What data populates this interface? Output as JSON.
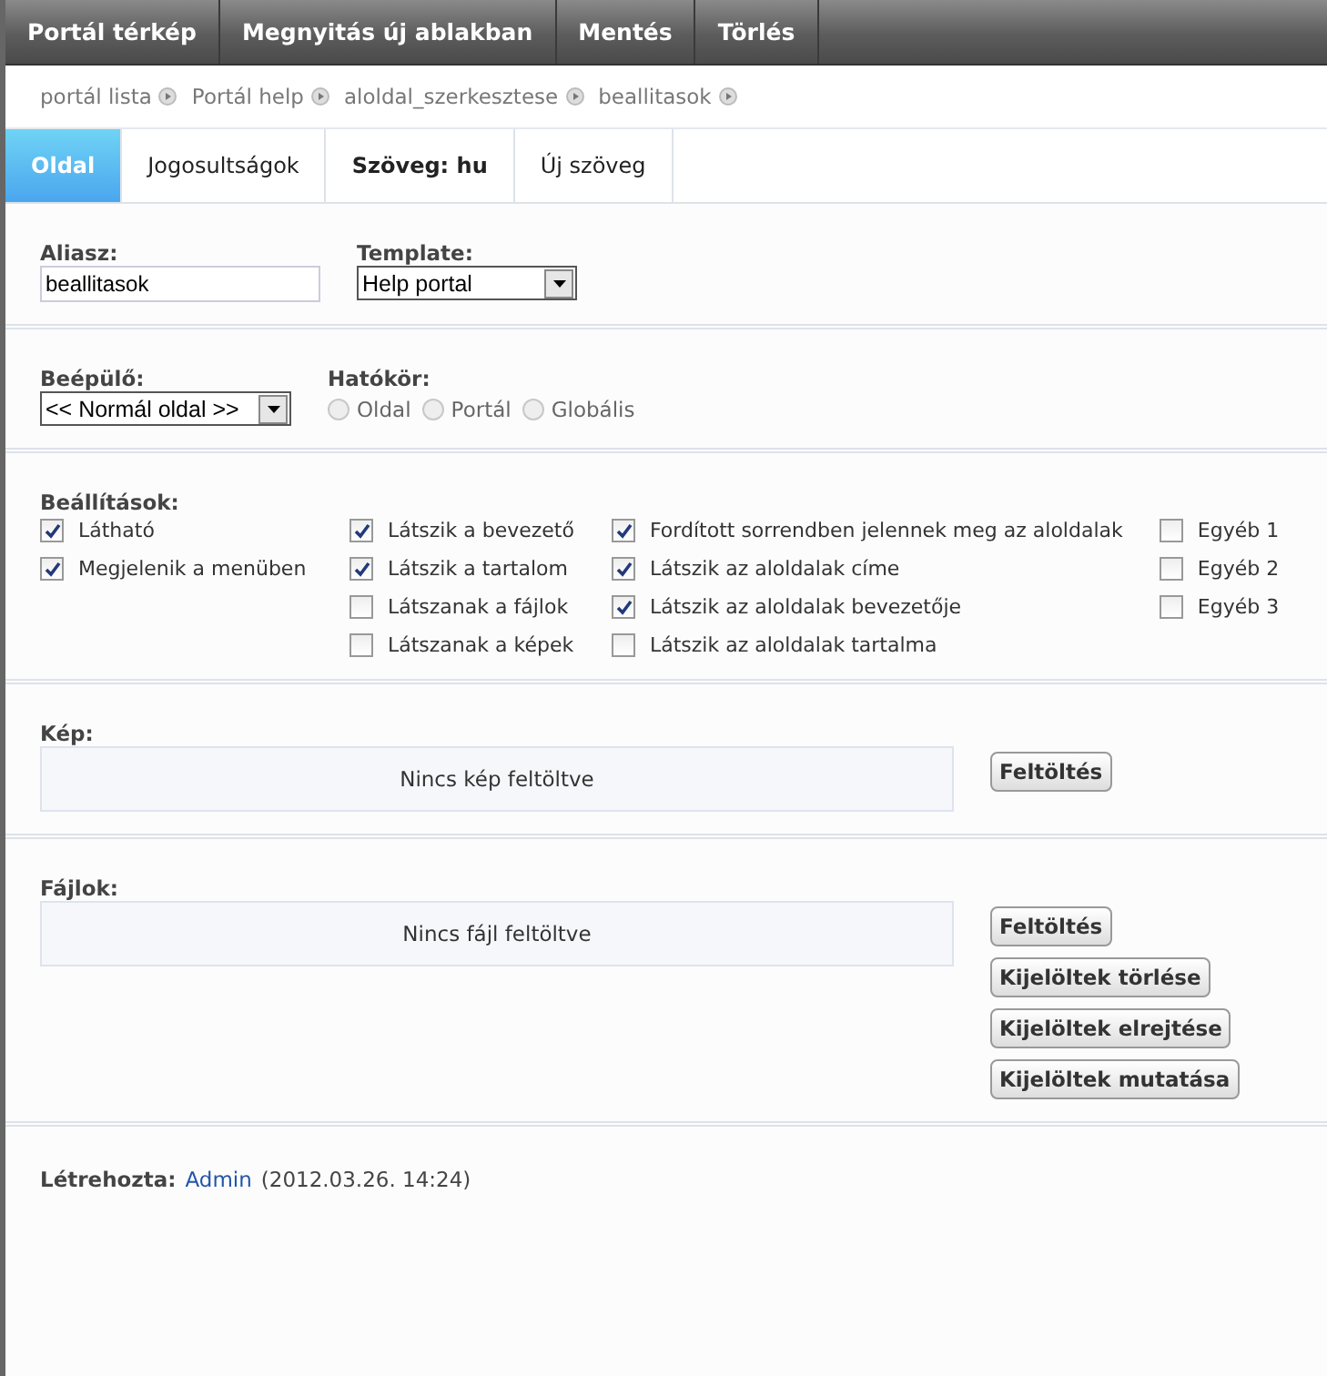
{
  "menu": [
    "Portál térkép",
    "Megnyitás új ablakban",
    "Mentés",
    "Törlés"
  ],
  "breadcrumb": [
    "portál lista",
    "Portál help",
    "aloldal_szerkesztese",
    "beallitasok"
  ],
  "tabs": [
    {
      "label": "Oldal",
      "selected": true,
      "bold": false
    },
    {
      "label": "Jogosultságok",
      "selected": false,
      "bold": false
    },
    {
      "label": "Szöveg: hu",
      "selected": false,
      "bold": true
    },
    {
      "label": "Új szöveg",
      "selected": false,
      "bold": false
    }
  ],
  "alias": {
    "label": "Aliasz:",
    "value": "beallitasok"
  },
  "template": {
    "label": "Template:",
    "value": "Help portal"
  },
  "plugin": {
    "label": "Beépülő:",
    "value": "<< Normál oldal >>"
  },
  "scope": {
    "label": "Hatókör:",
    "options": [
      {
        "label": "Oldal",
        "selected": false
      },
      {
        "label": "Portál",
        "selected": false
      },
      {
        "label": "Globális",
        "selected": false
      }
    ]
  },
  "settings": {
    "label": "Beállítások:",
    "columns": [
      [
        {
          "label": "Látható",
          "checked": true
        },
        {
          "label": "Megjelenik a menüben",
          "checked": true
        }
      ],
      [
        {
          "label": "Látszik a bevezető",
          "checked": true
        },
        {
          "label": "Látszik a tartalom",
          "checked": true
        },
        {
          "label": "Látszanak a fájlok",
          "checked": false
        },
        {
          "label": "Látszanak a képek",
          "checked": false
        }
      ],
      [
        {
          "label": "Fordított sorrendben jelennek meg az aloldalak",
          "checked": true
        },
        {
          "label": "Látszik az aloldalak címe",
          "checked": true
        },
        {
          "label": "Látszik az aloldalak bevezetője",
          "checked": true
        },
        {
          "label": "Látszik az aloldalak tartalma",
          "checked": false
        }
      ],
      [
        {
          "label": "Egyéb 1",
          "checked": false
        },
        {
          "label": "Egyéb 2",
          "checked": false
        },
        {
          "label": "Egyéb 3",
          "checked": false
        }
      ]
    ]
  },
  "image": {
    "label": "Kép:",
    "empty": "Nincs kép feltöltve",
    "buttons": [
      "Feltöltés"
    ]
  },
  "files": {
    "label": "Fájlok:",
    "empty": "Nincs fájl feltöltve",
    "buttons": [
      "Feltöltés",
      "Kijelöltek törlése",
      "Kijelöltek elrejtése",
      "Kijelöltek mutatása"
    ]
  },
  "footer": {
    "label": "Létrehozta:",
    "author": "Admin",
    "date": "(2012.03.26. 14:24)"
  }
}
